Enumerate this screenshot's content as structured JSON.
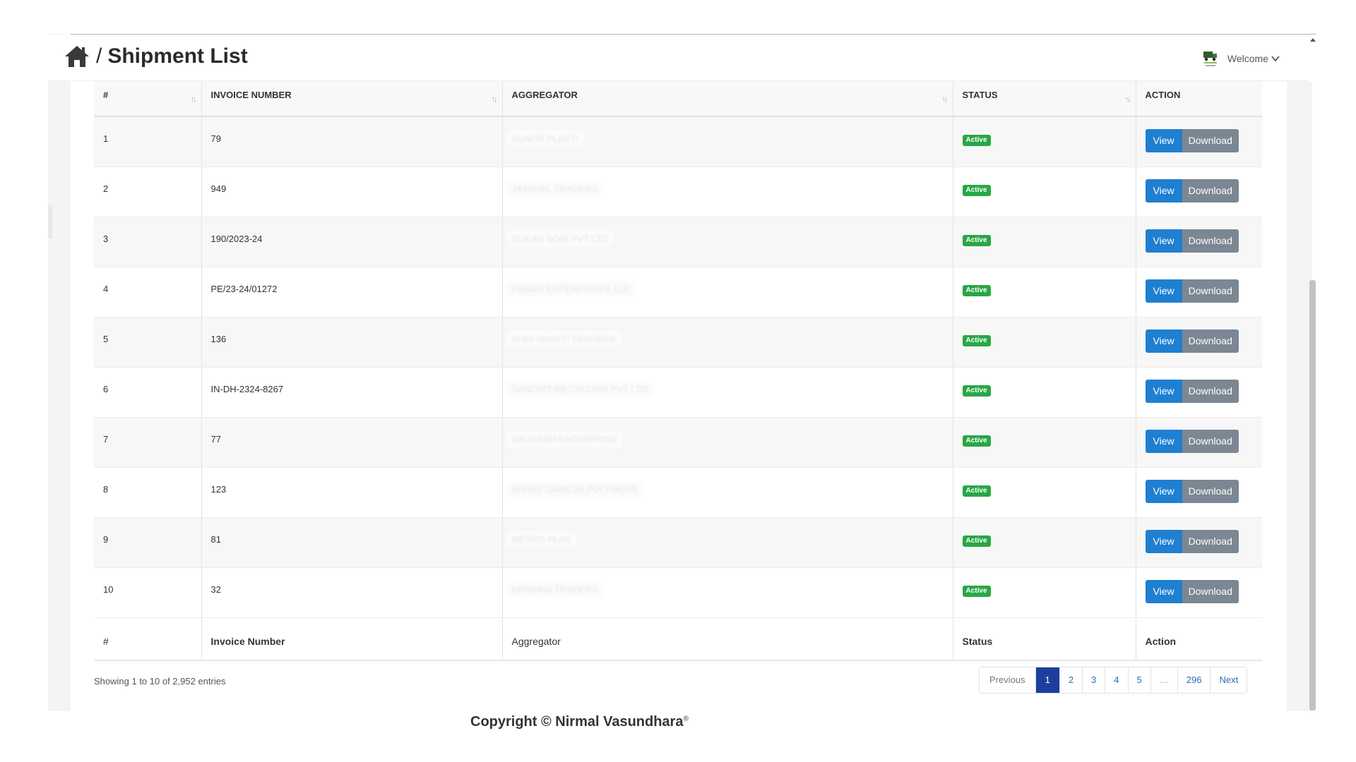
{
  "header": {
    "breadcrumb_separator": "/",
    "title": "Shipment List",
    "logo_label": "Nirmal Vasundhara truck logo",
    "welcome": "Welcome"
  },
  "table": {
    "columns": [
      "#",
      "INVOICE NUMBER",
      "AGGREGATOR",
      "STATUS",
      "ACTION"
    ],
    "footer_columns": [
      "#",
      "Invoice Number",
      "Aggregator",
      "Status",
      "Action"
    ],
    "rows": [
      {
        "num": "1",
        "invoice": "79",
        "aggregator": "SUNITA PLASTI",
        "status": "Active"
      },
      {
        "num": "2",
        "invoice": "949",
        "aggregator": "JAYSHAL TRADERS",
        "status": "Active"
      },
      {
        "num": "3",
        "invoice": "190/2023-24",
        "aggregator": "DUKAN SONI PVT LTD",
        "status": "Active"
      },
      {
        "num": "4",
        "invoice": "PE/23-24/01272",
        "aggregator": "PAWAN ENTERPRISES LLP",
        "status": "Active"
      },
      {
        "num": "5",
        "invoice": "136",
        "aggregator": "SHRI SHAKTI TRADERS",
        "status": "Active"
      },
      {
        "num": "6",
        "invoice": "IN-DH-2324-8267",
        "aggregator": "SANCHIT RECYCLING PVT LTD",
        "status": "Active"
      },
      {
        "num": "7",
        "invoice": "77",
        "aggregator": "SAURABH ENTERPRISE",
        "status": "Active"
      },
      {
        "num": "8",
        "invoice": "123",
        "aggregator": "SHREE GANESH POLYMERS",
        "status": "Active"
      },
      {
        "num": "9",
        "invoice": "81",
        "aggregator": "METRO PLAS",
        "status": "Active"
      },
      {
        "num": "10",
        "invoice": "32",
        "aggregator": "KRISHNA TRADERS",
        "status": "Active"
      }
    ],
    "view_label": "View",
    "download_label": "Download"
  },
  "showing": "Showing 1 to 10 of 2,952 entries",
  "pagination": {
    "previous": "Previous",
    "pages": [
      "1",
      "2",
      "3",
      "4",
      "5",
      "…",
      "296"
    ],
    "current": "1",
    "next": "Next"
  },
  "copyright": "Copyright © Nirmal Vasundhara",
  "copyright_mark": "®",
  "colors": {
    "view_button": "#1f7fd0",
    "download_button": "#7b8792",
    "active_badge": "#28a745",
    "current_page": "#1c3f9e",
    "link": "#2a6db5"
  }
}
